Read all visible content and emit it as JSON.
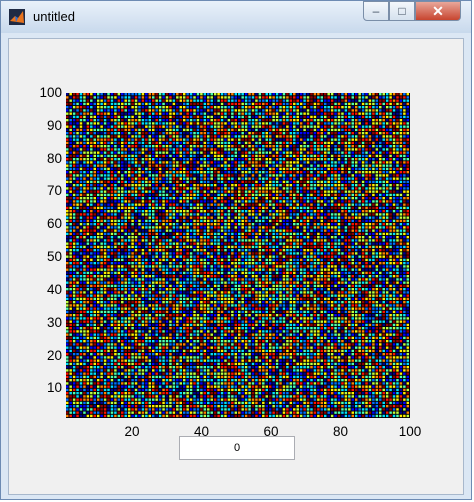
{
  "window": {
    "title": "untitled"
  },
  "title_buttons": {
    "minimize": "–",
    "maximize": "□",
    "close": "✕"
  },
  "colors": {
    "accent_close": "#c7452f",
    "plot_background": "#000000",
    "palette": [
      "#00008f",
      "#0000ff",
      "#006fff",
      "#00dfff",
      "#4fffaf",
      "#bfff3f",
      "#ffef00",
      "#ff8000",
      "#ff1000",
      "#8f0000"
    ]
  },
  "chart_data": {
    "type": "heatmap",
    "xlim": [
      1,
      100
    ],
    "ylim": [
      1,
      100
    ],
    "x_ticks": [
      "20",
      "40",
      "60",
      "80",
      "100"
    ],
    "y_ticks": [
      "10",
      "20",
      "30",
      "40",
      "50",
      "60",
      "70",
      "80",
      "90",
      "100"
    ],
    "grid_size": 100,
    "colormap": "jet"
  },
  "value_edit": {
    "value": "0"
  }
}
